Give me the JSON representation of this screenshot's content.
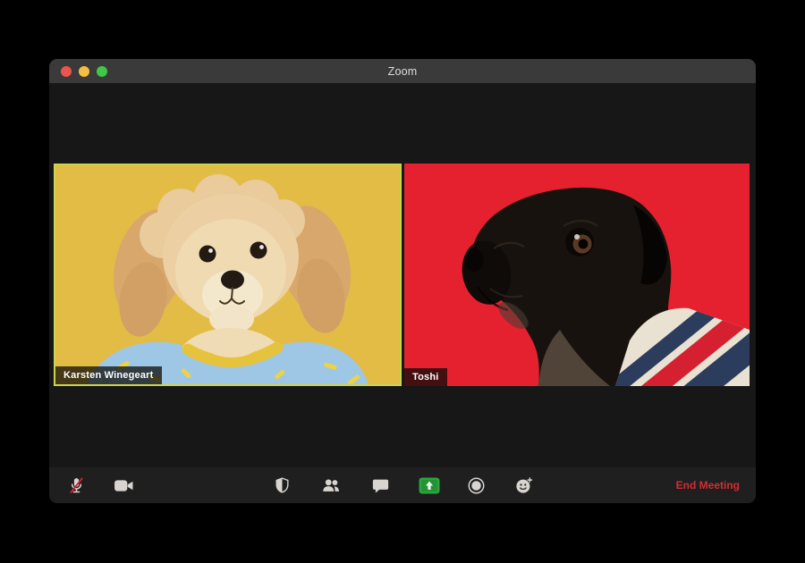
{
  "window": {
    "title": "Zoom",
    "traffic_lights": [
      {
        "name": "close",
        "color": "#ed544d"
      },
      {
        "name": "minimize",
        "color": "#f4bd44"
      },
      {
        "name": "zoom",
        "color": "#3ec846"
      }
    ]
  },
  "participants": [
    {
      "name": "Karsten Winegeart",
      "tile_bg": "#e2bc45",
      "active_speaker": true,
      "active_border_color": "#ccd54e",
      "video_desc": "fluffy cream puppy facing camera, wearing light-blue banana-print shirt with yellow collar, yellow studio background"
    },
    {
      "name": "Toshi",
      "tile_bg": "#e52130",
      "active_speaker": false,
      "video_desc": "black pug in left-facing profile wearing cream, navy and red striped sweater, red studio background"
    }
  ],
  "toolbar": {
    "buttons": [
      {
        "name": "mute",
        "icon": "microphone-muted-icon",
        "state": "muted",
        "slash_color": "#d8222c"
      },
      {
        "name": "video",
        "icon": "video-camera-icon",
        "state": "on"
      },
      {
        "name": "security",
        "icon": "shield-icon"
      },
      {
        "name": "participants",
        "icon": "participants-icon"
      },
      {
        "name": "chat",
        "icon": "chat-bubble-icon"
      },
      {
        "name": "share-screen",
        "icon": "share-screen-icon",
        "accent": "#2aa63c"
      },
      {
        "name": "record",
        "icon": "record-icon"
      },
      {
        "name": "reactions",
        "icon": "reactions-smiley-icon"
      }
    ],
    "end_meeting": {
      "label": "End Meeting",
      "color": "#d02e35"
    }
  }
}
